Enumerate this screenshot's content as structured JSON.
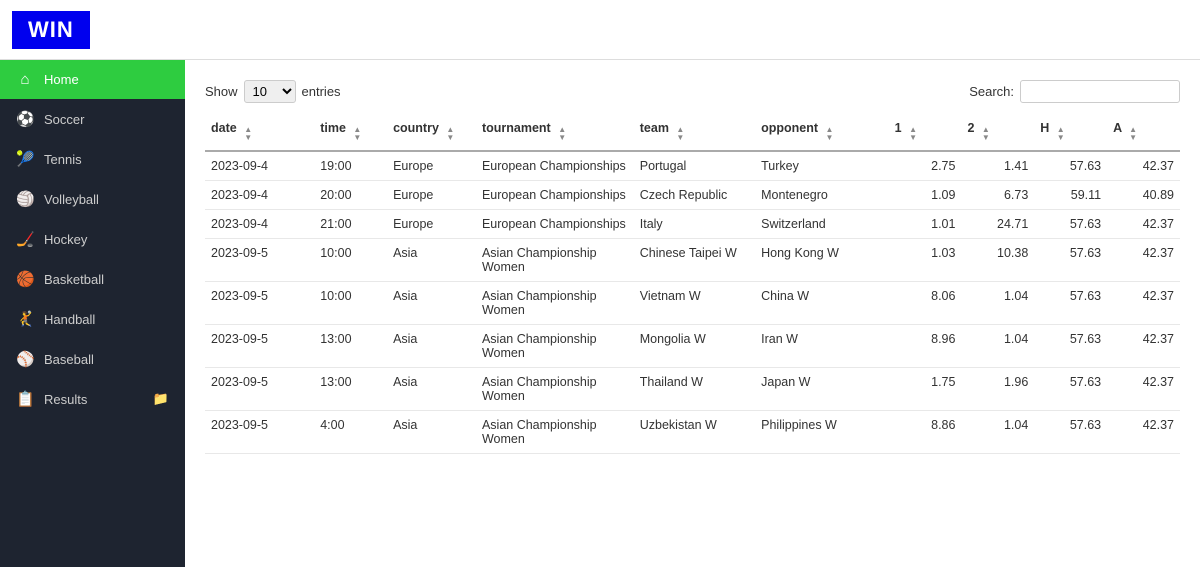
{
  "logo": {
    "text": "WIN"
  },
  "sidebar": {
    "items": [
      {
        "id": "home",
        "label": "Home",
        "icon": "⌂",
        "active": true
      },
      {
        "id": "soccer",
        "label": "Soccer",
        "icon": "○"
      },
      {
        "id": "tennis",
        "label": "Tennis",
        "icon": "○"
      },
      {
        "id": "volleyball",
        "label": "Volleyball",
        "icon": "○"
      },
      {
        "id": "hockey",
        "label": "Hockey",
        "icon": "○"
      },
      {
        "id": "basketball",
        "label": "Basketball",
        "icon": "○"
      },
      {
        "id": "handball",
        "label": "Handball",
        "icon": "○"
      },
      {
        "id": "baseball",
        "label": "Baseball",
        "icon": "○"
      },
      {
        "id": "results",
        "label": "Results",
        "icon": "○",
        "hasFolder": true
      }
    ]
  },
  "controls": {
    "show_label": "Show",
    "entries_label": "entries",
    "entries_value": "10",
    "search_label": "Search:",
    "search_placeholder": ""
  },
  "table": {
    "columns": [
      {
        "key": "date",
        "label": "date"
      },
      {
        "key": "time",
        "label": "time"
      },
      {
        "key": "country",
        "label": "country"
      },
      {
        "key": "tournament",
        "label": "tournament"
      },
      {
        "key": "team",
        "label": "team"
      },
      {
        "key": "opponent",
        "label": "opponent"
      },
      {
        "key": "1",
        "label": "1"
      },
      {
        "key": "2",
        "label": "2"
      },
      {
        "key": "H",
        "label": "H"
      },
      {
        "key": "A",
        "label": "A"
      }
    ],
    "rows": [
      {
        "date": "2023-09-4",
        "time": "19:00",
        "country": "Europe",
        "tournament": "European Championships",
        "team": "Portugal",
        "opponent": "Turkey",
        "v1": "2.75",
        "v2": "1.41",
        "H": "57.63",
        "A": "42.37"
      },
      {
        "date": "2023-09-4",
        "time": "20:00",
        "country": "Europe",
        "tournament": "European Championships",
        "team": "Czech Republic",
        "opponent": "Montenegro",
        "v1": "1.09",
        "v2": "6.73",
        "H": "59.11",
        "A": "40.89"
      },
      {
        "date": "2023-09-4",
        "time": "21:00",
        "country": "Europe",
        "tournament": "European Championships",
        "team": "Italy",
        "opponent": "Switzerland",
        "v1": "1.01",
        "v2": "24.71",
        "H": "57.63",
        "A": "42.37"
      },
      {
        "date": "2023-09-5",
        "time": "10:00",
        "country": "Asia",
        "tournament": "Asian Championship Women",
        "team": "Chinese Taipei W",
        "opponent": "Hong Kong W",
        "v1": "1.03",
        "v2": "10.38",
        "H": "57.63",
        "A": "42.37"
      },
      {
        "date": "2023-09-5",
        "time": "10:00",
        "country": "Asia",
        "tournament": "Asian Championship Women",
        "team": "Vietnam W",
        "opponent": "China W",
        "v1": "8.06",
        "v2": "1.04",
        "H": "57.63",
        "A": "42.37"
      },
      {
        "date": "2023-09-5",
        "time": "13:00",
        "country": "Asia",
        "tournament": "Asian Championship Women",
        "team": "Mongolia W",
        "opponent": "Iran W",
        "v1": "8.96",
        "v2": "1.04",
        "H": "57.63",
        "A": "42.37"
      },
      {
        "date": "2023-09-5",
        "time": "13:00",
        "country": "Asia",
        "tournament": "Asian Championship Women",
        "team": "Thailand W",
        "opponent": "Japan W",
        "v1": "1.75",
        "v2": "1.96",
        "H": "57.63",
        "A": "42.37"
      },
      {
        "date": "2023-09-5",
        "time": "4:00",
        "country": "Asia",
        "tournament": "Asian Championship Women",
        "team": "Uzbekistan W",
        "opponent": "Philippines W",
        "v1": "8.86",
        "v2": "1.04",
        "H": "57.63",
        "A": "42.37"
      }
    ]
  }
}
